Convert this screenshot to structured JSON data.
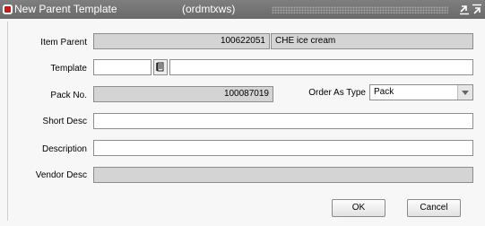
{
  "window": {
    "title": "New Parent Template",
    "module": "(ordmtxws)",
    "icon": "oracle-forms-icon"
  },
  "fields": {
    "item_parent": {
      "label": "Item Parent",
      "number": "100622051",
      "description": "CHE ice cream"
    },
    "template": {
      "label": "Template",
      "value": "",
      "description": ""
    },
    "pack_no": {
      "label": "Pack No.",
      "value": "100087019"
    },
    "order_as_type": {
      "label": "Order As Type",
      "value": "Pack"
    },
    "short_desc": {
      "label": "Short Desc",
      "value": ""
    },
    "description": {
      "label": "Description",
      "value": ""
    },
    "vendor_desc": {
      "label": "Vendor Desc",
      "value": ""
    }
  },
  "buttons": {
    "ok": "OK",
    "cancel": "Cancel"
  },
  "colors": {
    "titlebar": "#747474",
    "readonly_field": "#d4d4d4",
    "background": "#f7f7f7"
  }
}
